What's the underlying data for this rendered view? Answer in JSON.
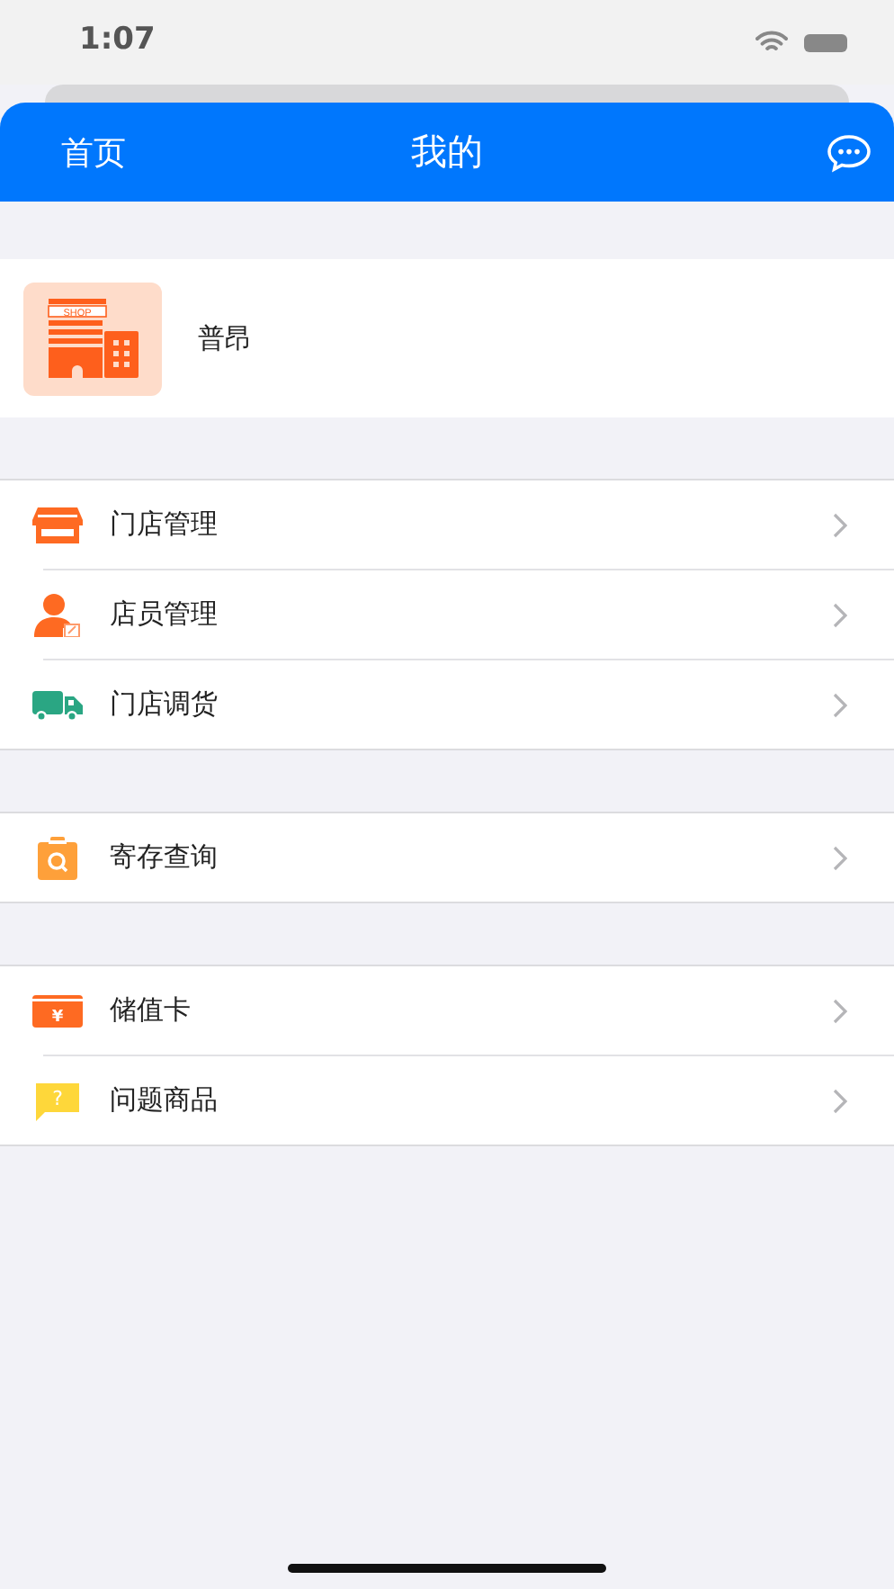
{
  "status_bar": {
    "time": "1:07"
  },
  "nav": {
    "back": "首页",
    "title": "我的"
  },
  "profile": {
    "logo_text": "SHOP",
    "name": "普昂"
  },
  "groups": [
    {
      "items": [
        {
          "kind": "store",
          "label": "门店管理"
        },
        {
          "kind": "staff",
          "label": "店员管理"
        },
        {
          "kind": "truck",
          "label": "门店调货"
        }
      ]
    },
    {
      "items": [
        {
          "kind": "bag",
          "label": "寄存查询"
        }
      ]
    },
    {
      "items": [
        {
          "kind": "card",
          "label": "储值卡",
          "glyph": "¥"
        },
        {
          "kind": "question",
          "label": "问题商品",
          "glyph": "?"
        }
      ]
    }
  ]
}
